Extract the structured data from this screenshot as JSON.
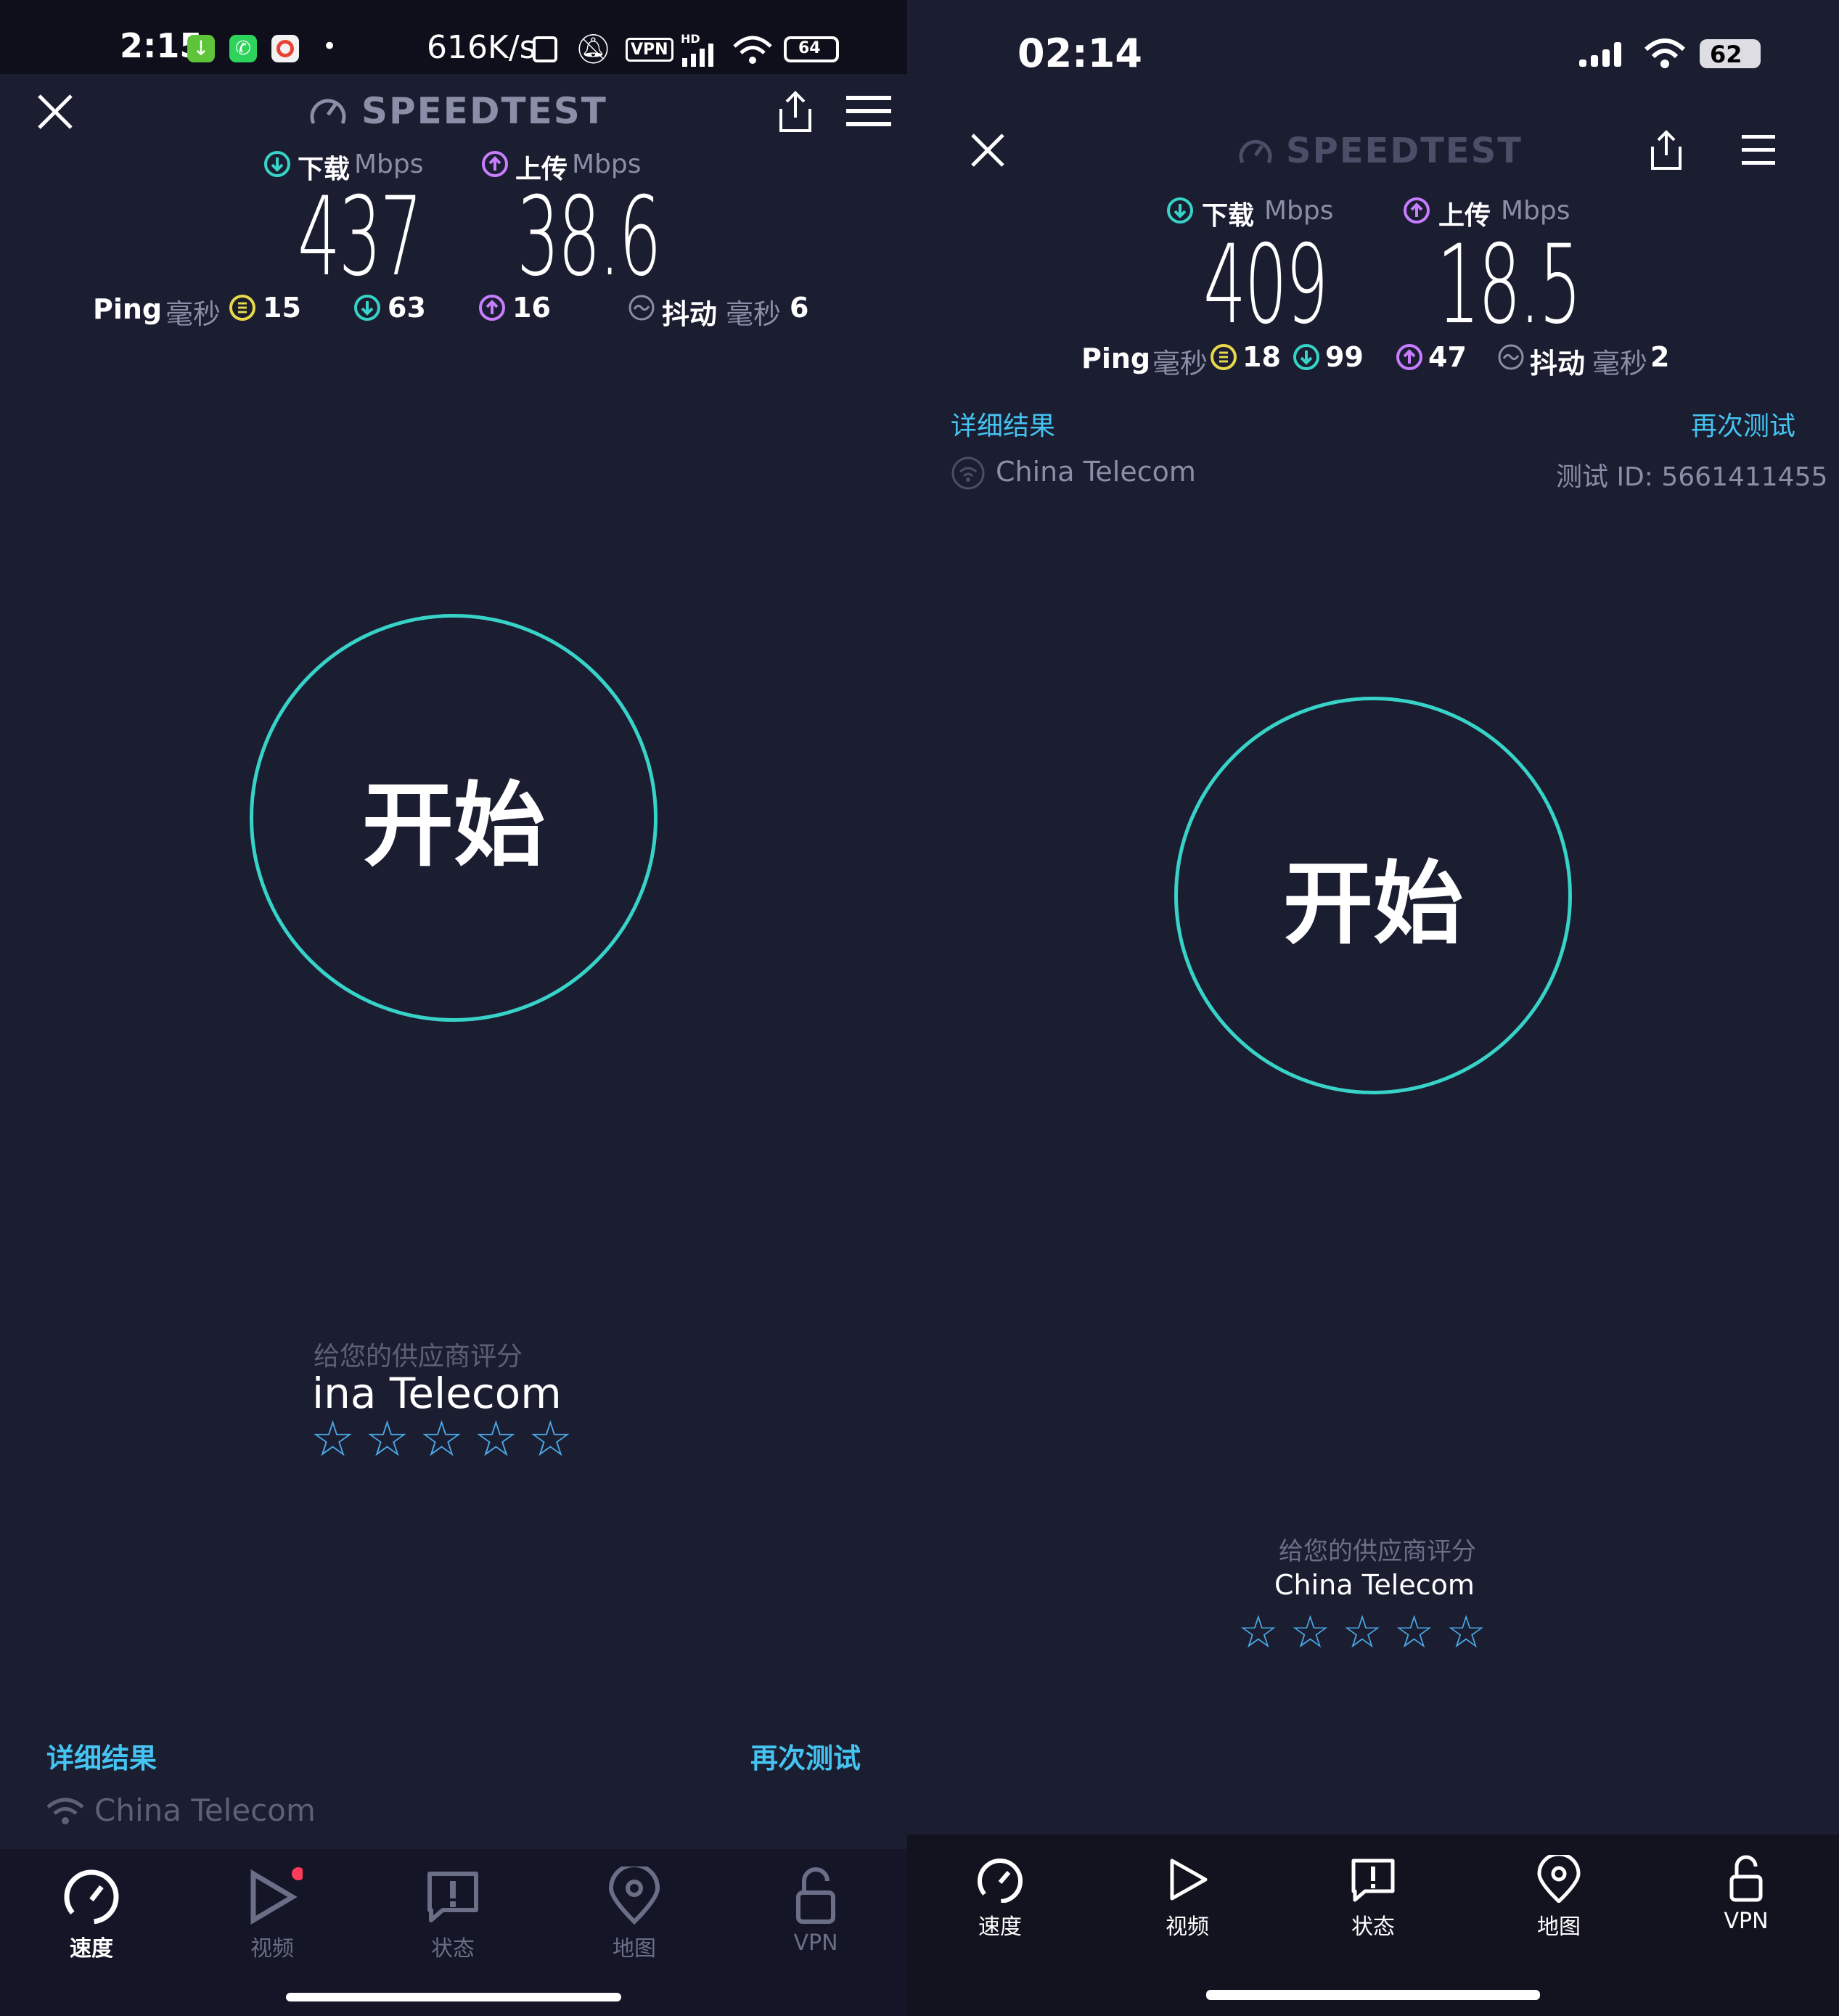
{
  "left": {
    "status": {
      "time": "2:15",
      "net_speed": "616K/s",
      "vpn": "VPN",
      "hd": "HD",
      "battery": "64",
      "dot": "•"
    },
    "header": {
      "brand": "SPEEDTEST"
    },
    "download": {
      "label": "下载",
      "unit": "Mbps",
      "value": "437"
    },
    "upload": {
      "label": "上传",
      "unit": "Mbps",
      "value": "38.6"
    },
    "ping": {
      "label": "Ping",
      "unit": "毫秒",
      "idle": "15",
      "down": "63",
      "up": "16"
    },
    "jitter": {
      "label": "抖动",
      "unit": "毫秒",
      "value": "6"
    },
    "start_label": "开始",
    "rate": {
      "prompt": "给您的供应商评分",
      "provider": "ina Telecom",
      "stars": [
        "☆",
        "☆",
        "☆",
        "☆",
        "☆"
      ]
    },
    "details_link": "详细结果",
    "retest_link": "再次测试",
    "provider": "China Telecom",
    "nav": [
      {
        "label": "速度",
        "icon": "speed-gauge-icon",
        "active": true
      },
      {
        "label": "视频",
        "icon": "play-icon",
        "active": false
      },
      {
        "label": "状态",
        "icon": "alert-icon",
        "active": false
      },
      {
        "label": "地图",
        "icon": "map-pin-icon",
        "active": false
      },
      {
        "label": "VPN",
        "icon": "lock-icon",
        "active": false
      }
    ]
  },
  "right": {
    "status": {
      "time": "02:14",
      "battery": "62"
    },
    "header": {
      "brand": "SPEEDTEST"
    },
    "download": {
      "label": "下载",
      "unit": "Mbps",
      "value": "409"
    },
    "upload": {
      "label": "上传",
      "unit": "Mbps",
      "value": "18.5"
    },
    "ping": {
      "label": "Ping",
      "unit": "毫秒",
      "idle": "18",
      "down": "99",
      "up": "47"
    },
    "jitter": {
      "label": "抖动",
      "unit": "毫秒",
      "value": "2"
    },
    "details_link": "详细结果",
    "retest_link": "再次测试",
    "provider": "China Telecom",
    "test_id": "测试 ID: 5661411455",
    "start_label": "开始",
    "rate": {
      "prompt": "给您的供应商评分",
      "provider": "China Telecom",
      "stars": [
        "☆",
        "☆",
        "☆",
        "☆",
        "☆"
      ]
    },
    "nav": [
      {
        "label": "速度",
        "icon": "speed-gauge-icon",
        "active": true
      },
      {
        "label": "视频",
        "icon": "play-icon",
        "active": false
      },
      {
        "label": "状态",
        "icon": "alert-icon",
        "active": false
      },
      {
        "label": "地图",
        "icon": "map-pin-icon",
        "active": false
      },
      {
        "label": "VPN",
        "icon": "lock-icon",
        "active": false
      }
    ]
  },
  "colors": {
    "background": "#1b1d31",
    "accent_cyan": "#37d3c8",
    "link_blue": "#45c4f2",
    "download_green": "#37d3c8",
    "upload_purple": "#c77dff",
    "ping_yellow": "#e8d84a",
    "star_blue": "#4aa8e6",
    "notification_red": "#ff3b5c"
  }
}
